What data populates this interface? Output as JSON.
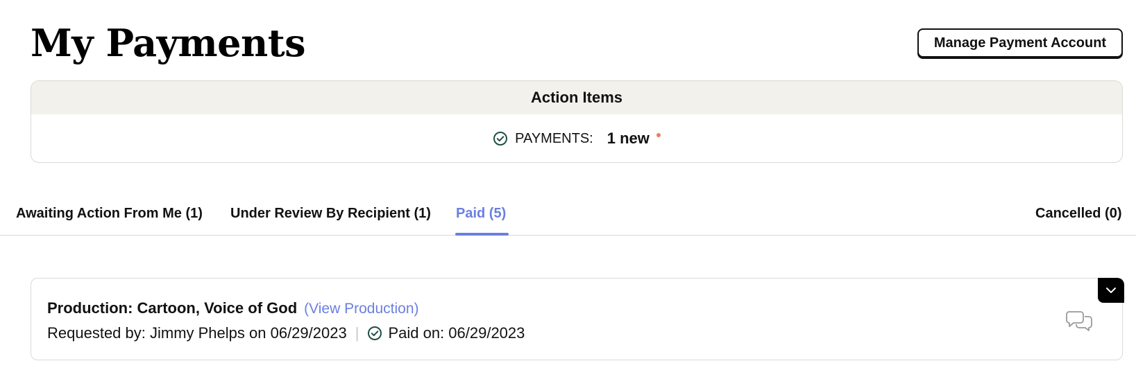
{
  "header": {
    "title": "My Payments",
    "manage_button": "Manage Payment Account"
  },
  "action_items": {
    "title": "Action Items",
    "payments_label": "PAYMENTS:",
    "payments_count": "1 new",
    "icon": "check-circle-icon",
    "new_dot_color": "#f07b5a"
  },
  "tabs": [
    {
      "label": "Awaiting Action From Me (1)",
      "active": false
    },
    {
      "label": "Under Review By Recipient (1)",
      "active": false
    },
    {
      "label": "Paid (5)",
      "active": true
    },
    {
      "label": "Cancelled (0)",
      "active": false
    }
  ],
  "accent_color": "#6b7fe0",
  "payments": [
    {
      "title": "Production: Cartoon, Voice of God",
      "link": "(View Production)",
      "requested": "Requested by: Jimmy Phelps on 06/29/2023",
      "separator": "|",
      "paid": "Paid on: 06/29/2023",
      "icons": [
        "check-circle-icon",
        "chat-bubbles-icon",
        "chevron-down-icon"
      ]
    }
  ]
}
